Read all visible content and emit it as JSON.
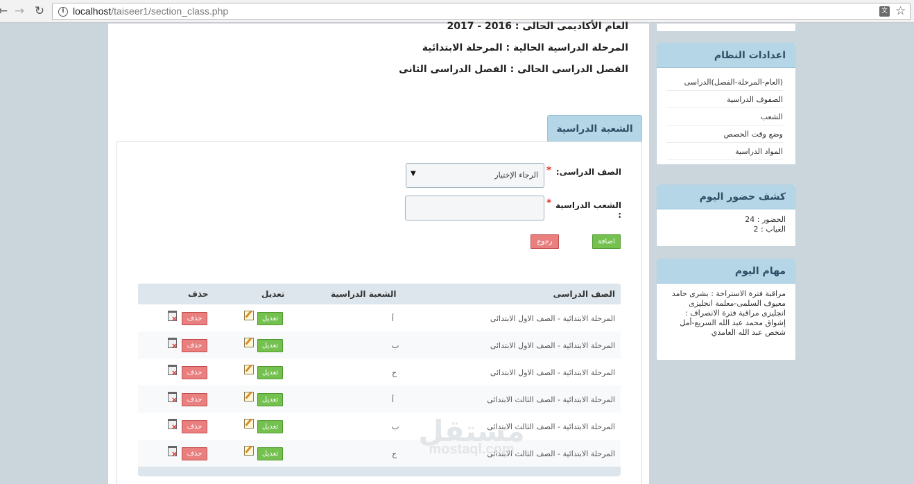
{
  "browser": {
    "url_host": "localhost",
    "url_path": "/taiseer1/section_class.php"
  },
  "info": {
    "academic_year": "العام الأكاديمى الحالى : 2016 - 2017",
    "stage": "المرحلة الدراسية الحالية : المرحلة الابتدائية",
    "semester": "الفصل الدراسى الحالى : الفصل الدراسى الثانى"
  },
  "form": {
    "tab_title": "الشعبة الدراسية",
    "class_label": "الصف الدراسى:",
    "class_required": "*",
    "class_selected": "الرجاء الإختيار",
    "section_label": "الشعب الدراسية",
    "section_label_suffix": ":",
    "section_required": "*",
    "section_value": "",
    "add_button": "اضافة",
    "back_button": "رجوع"
  },
  "table": {
    "headers": {
      "class": "الصف الدراسى",
      "section": "الشعبة الدراسية",
      "edit": "تعديل",
      "delete": "حذف"
    },
    "edit_label": "تعديل",
    "delete_label": "حذف",
    "rows": [
      {
        "class": "المرحلة الابتدائية - الصف الاول الابتدائى",
        "section": "أ"
      },
      {
        "class": "المرحلة الابتدائية - الصف الاول الابتدائى",
        "section": "ب"
      },
      {
        "class": "المرحلة الابتدائية - الصف الاول الابتدائى",
        "section": "ج"
      },
      {
        "class": "المرحلة الابتدائية - الصف الثالث الابتدائى",
        "section": "أ"
      },
      {
        "class": "المرحلة الابتدائية - الصف الثالث الابتدائى",
        "section": "ب"
      },
      {
        "class": "المرحلة الابتدائية - الصف الثالث الابتدائى",
        "section": "ج"
      }
    ]
  },
  "sidebar": {
    "settings_title": "اعدادات النظام",
    "settings_links": [
      "(العام-المرحلة-الفصل)الدراسى",
      "الصفوف الدراسية",
      "الشعب",
      "وضع وقت الحصص",
      "المواد الدراسية"
    ],
    "attendance_title": "كشف حضور اليوم",
    "attendance_present": "الحضور : 24",
    "attendance_absent": "الغياب : 2",
    "tasks_title": "مهام اليوم",
    "tasks_text": "مراقبة فترة الاستراحة : بشرى حامد معيوف السلمى-معلمة انجليزى انجليزى مراقبة فترة الانصراف : إشواق محمد عبد الله السريع-أمل شخص عبد الله الغامدي"
  },
  "watermark": {
    "arabic": "مستقل",
    "latin": "mostaql.com"
  }
}
